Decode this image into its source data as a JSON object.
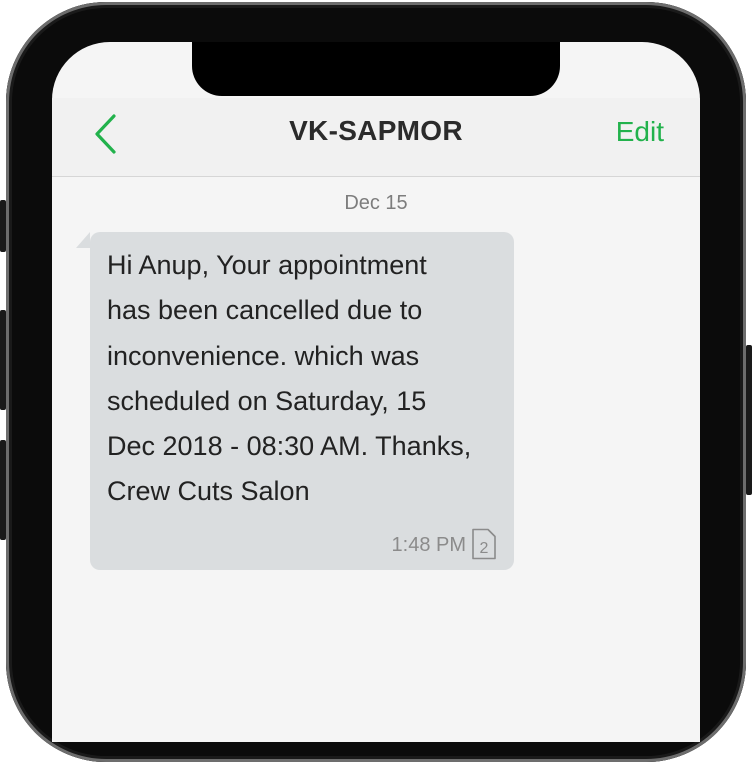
{
  "header": {
    "back_icon": "chevron-left-icon",
    "title": "VK-SAPMOR",
    "edit_label": "Edit"
  },
  "conversation": {
    "date": "Dec 15",
    "messages": [
      {
        "text": "Hi Anup, Your appointment\nhas been cancelled due to\ninconvenience. which was\nscheduled on Saturday, 15\nDec 2018 - 08:30 AM. Thanks,\nCrew Cuts Salon",
        "time": "1:48 PM",
        "sim_icon": "sim-card-icon",
        "sim_slot": "2"
      }
    ]
  },
  "colors": {
    "accent": "#22b24c",
    "bubble": "#dadddf",
    "screen_background": "#f5f5f5"
  }
}
